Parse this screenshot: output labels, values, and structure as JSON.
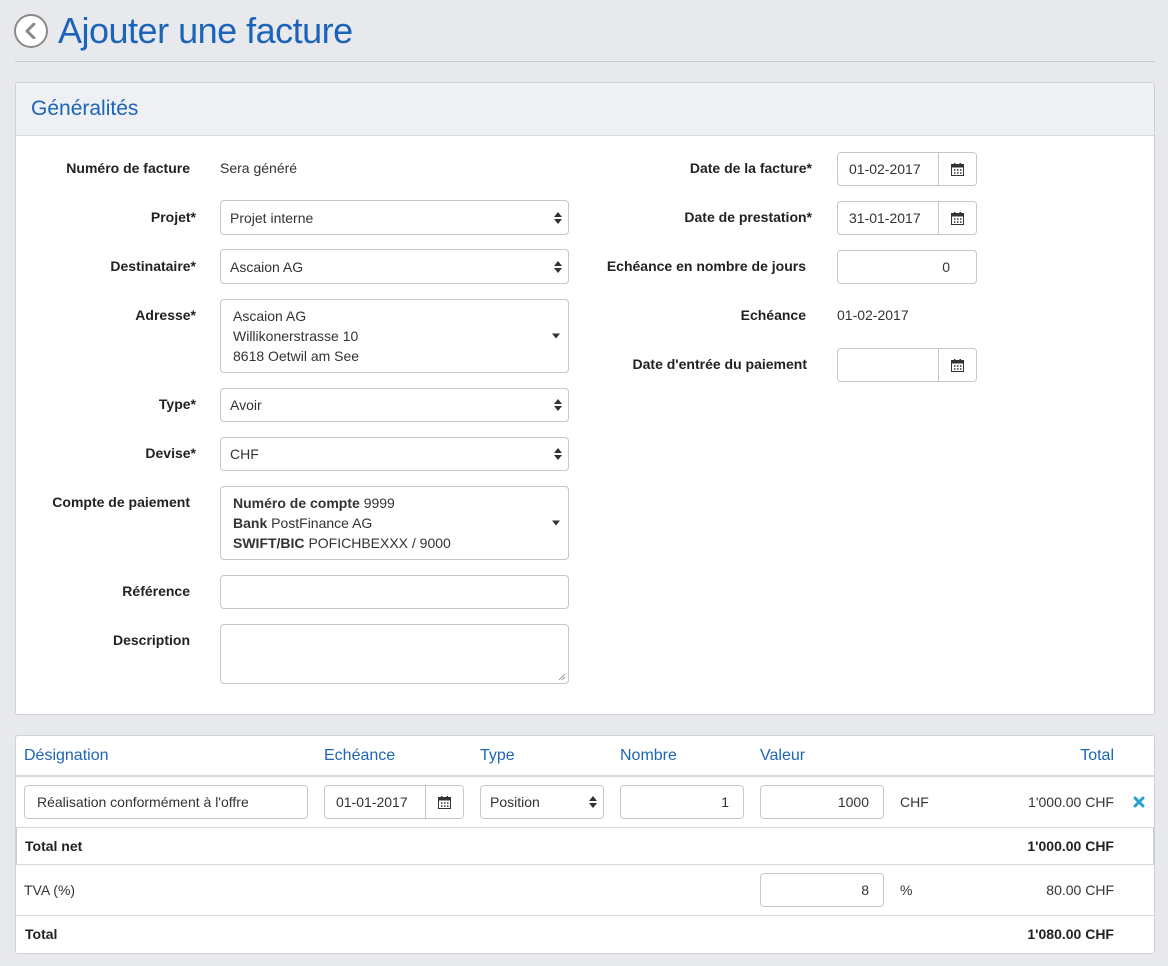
{
  "header": {
    "title": "Ajouter une facture"
  },
  "generalites": {
    "title": "Généralités",
    "left": {
      "numero": {
        "label": "Numéro de facture",
        "value": "Sera généré"
      },
      "projet": {
        "label": "Projet*",
        "value": "Projet interne"
      },
      "destinataire": {
        "label": "Destinataire*",
        "value": "Ascaion AG"
      },
      "adresse": {
        "label": "Adresse*",
        "lines": [
          "Ascaion AG",
          "Willikonerstrasse 10",
          "8618 Oetwil am See"
        ]
      },
      "type": {
        "label": "Type*",
        "value": "Avoir"
      },
      "devise": {
        "label": "Devise*",
        "value": "CHF"
      },
      "compte": {
        "label": "Compte de paiement",
        "lines": [
          {
            "key": "Numéro de compte",
            "value": "9999"
          },
          {
            "key": "Bank",
            "value": "PostFinance AG"
          },
          {
            "key": "SWIFT/BIC",
            "value": "POFICHBEXXX / 9000"
          }
        ]
      },
      "reference": {
        "label": "Référence",
        "value": ""
      },
      "description": {
        "label": "Description",
        "value": ""
      }
    },
    "right": {
      "date_facture": {
        "label": "Date de la facture*",
        "value": "01-02-2017"
      },
      "date_prestation": {
        "label": "Date de prestation*",
        "value": "31-01-2017"
      },
      "echeance_jours": {
        "label": "Echéance en nombre de jours",
        "value": "0"
      },
      "echeance": {
        "label": "Echéance",
        "value": "01-02-2017"
      },
      "date_paiement": {
        "label": "Date d'entrée du paiement",
        "value": ""
      }
    }
  },
  "positions": {
    "headers": {
      "designation": "Désignation",
      "echeance": "Echéance",
      "type": "Type",
      "nombre": "Nombre",
      "valeur": "Valeur",
      "total": "Total"
    },
    "items": [
      {
        "designation": "Réalisation conformément à l'offre",
        "echeance": "01-01-2017",
        "type": "Position",
        "nombre": "1",
        "valeur": "1000",
        "currency": "CHF",
        "total": "1'000.00 CHF"
      }
    ],
    "total_net": {
      "label": "Total net",
      "value": "1'000.00 CHF"
    },
    "tva": {
      "label": "TVA (%)",
      "rate": "8",
      "unit": "%",
      "value": "80.00 CHF"
    },
    "total": {
      "label": "Total",
      "value": "1'080.00 CHF"
    }
  },
  "colors": {
    "accent": "#1c64b8",
    "remove": "#2a9fd6",
    "background": "#e8e9ed"
  },
  "icons": {
    "back": "chevron-left-circle",
    "calendar": "calendar",
    "remove": "cross",
    "select": "up-down-arrows",
    "dropdown": "caret-down"
  }
}
